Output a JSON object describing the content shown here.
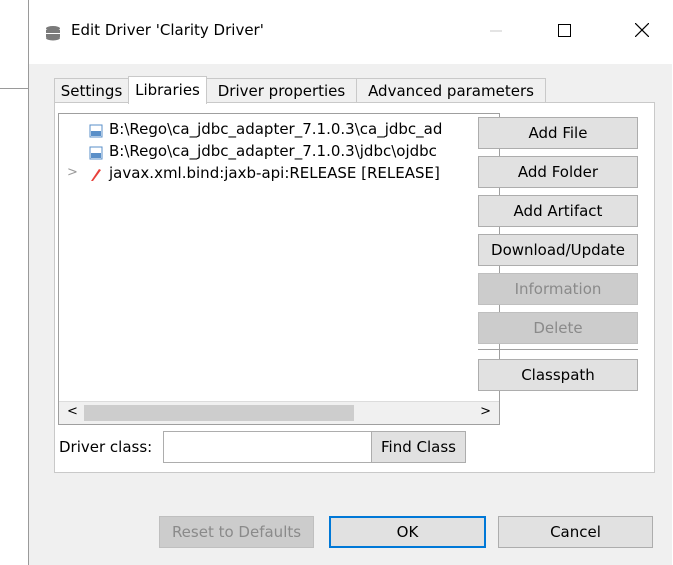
{
  "window": {
    "title": "Edit Driver 'Clarity Driver'",
    "icons": {
      "app": "database-icon",
      "minimize": "minimize-icon",
      "maximize": "maximize-icon",
      "close": "close-icon"
    }
  },
  "tabs": [
    {
      "label": "Settings",
      "active": false
    },
    {
      "label": "Libraries",
      "active": true
    },
    {
      "label": "Driver properties",
      "active": false
    },
    {
      "label": "Advanced parameters",
      "active": false
    }
  ],
  "libraries": {
    "items": [
      {
        "label": "B:\\Rego\\ca_jdbc_adapter_7.1.0.3\\ca_jdbc_ad",
        "icon": "jar-file-icon",
        "expandable": false
      },
      {
        "label": "B:\\Rego\\ca_jdbc_adapter_7.1.0.3\\jdbc\\ojdbc",
        "icon": "jar-file-icon",
        "expandable": false
      },
      {
        "label": "javax.xml.bind:jaxb-api:RELEASE [RELEASE]",
        "icon": "maven-artifact-icon",
        "expandable": true
      }
    ],
    "scroll_left": "<",
    "scroll_right": ">"
  },
  "side_buttons": {
    "add_file": "Add File",
    "add_folder": "Add Folder",
    "add_artifact": "Add Artifact",
    "download_update": "Download/Update",
    "information": "Information",
    "delete": "Delete",
    "classpath": "Classpath"
  },
  "driver_class": {
    "label": "Driver class:",
    "value": "",
    "find_class": "Find Class"
  },
  "footer": {
    "reset": "Reset to Defaults",
    "ok": "OK",
    "cancel": "Cancel"
  },
  "colors": {
    "accent": "#0078d7",
    "disabled_bg": "#cccccc",
    "disabled_text": "#8a8a8a",
    "artifact_icon": "#e8403a"
  }
}
